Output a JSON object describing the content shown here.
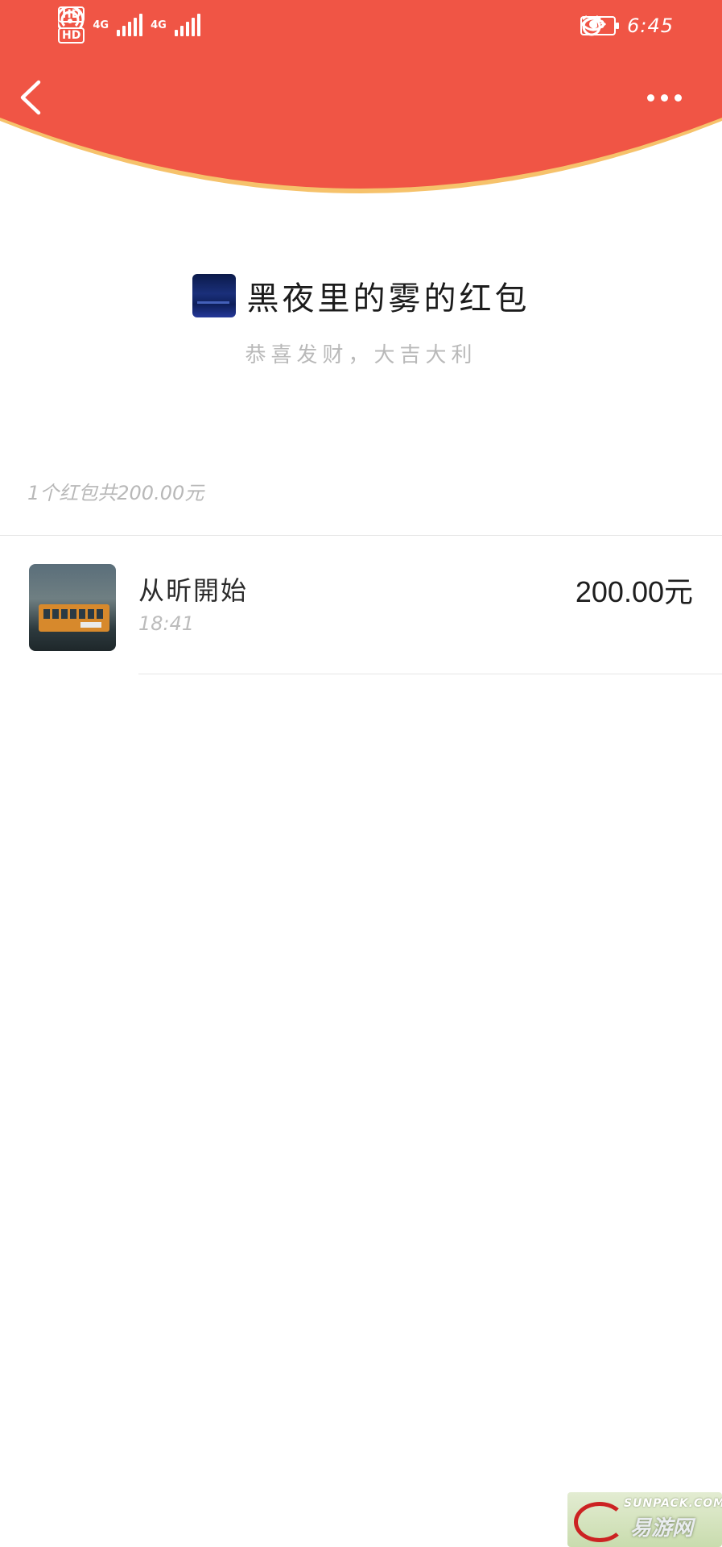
{
  "colors": {
    "header_red": "#f05545",
    "header_edge": "#f6c26b",
    "amount_text": "#1e1e1e",
    "muted_text": "#b8b8b8"
  },
  "status_bar": {
    "hd1": "HD",
    "hd2": "HD",
    "net1": "4G",
    "net2": "4G",
    "battery": "33",
    "time": "6:45"
  },
  "header": {
    "back_icon": "chevron-left-icon",
    "more_icon": "more-dots-icon"
  },
  "packet": {
    "title": "黑夜里的雾的红包",
    "greeting": "恭喜发财，大吉大利",
    "summary": "1个红包共200.00元"
  },
  "receivers": [
    {
      "name": "从昕開始",
      "time": "18:41",
      "amount": "200.00元"
    }
  ],
  "watermark": {
    "top": "SUNPACK.COM",
    "main": "易游网"
  }
}
